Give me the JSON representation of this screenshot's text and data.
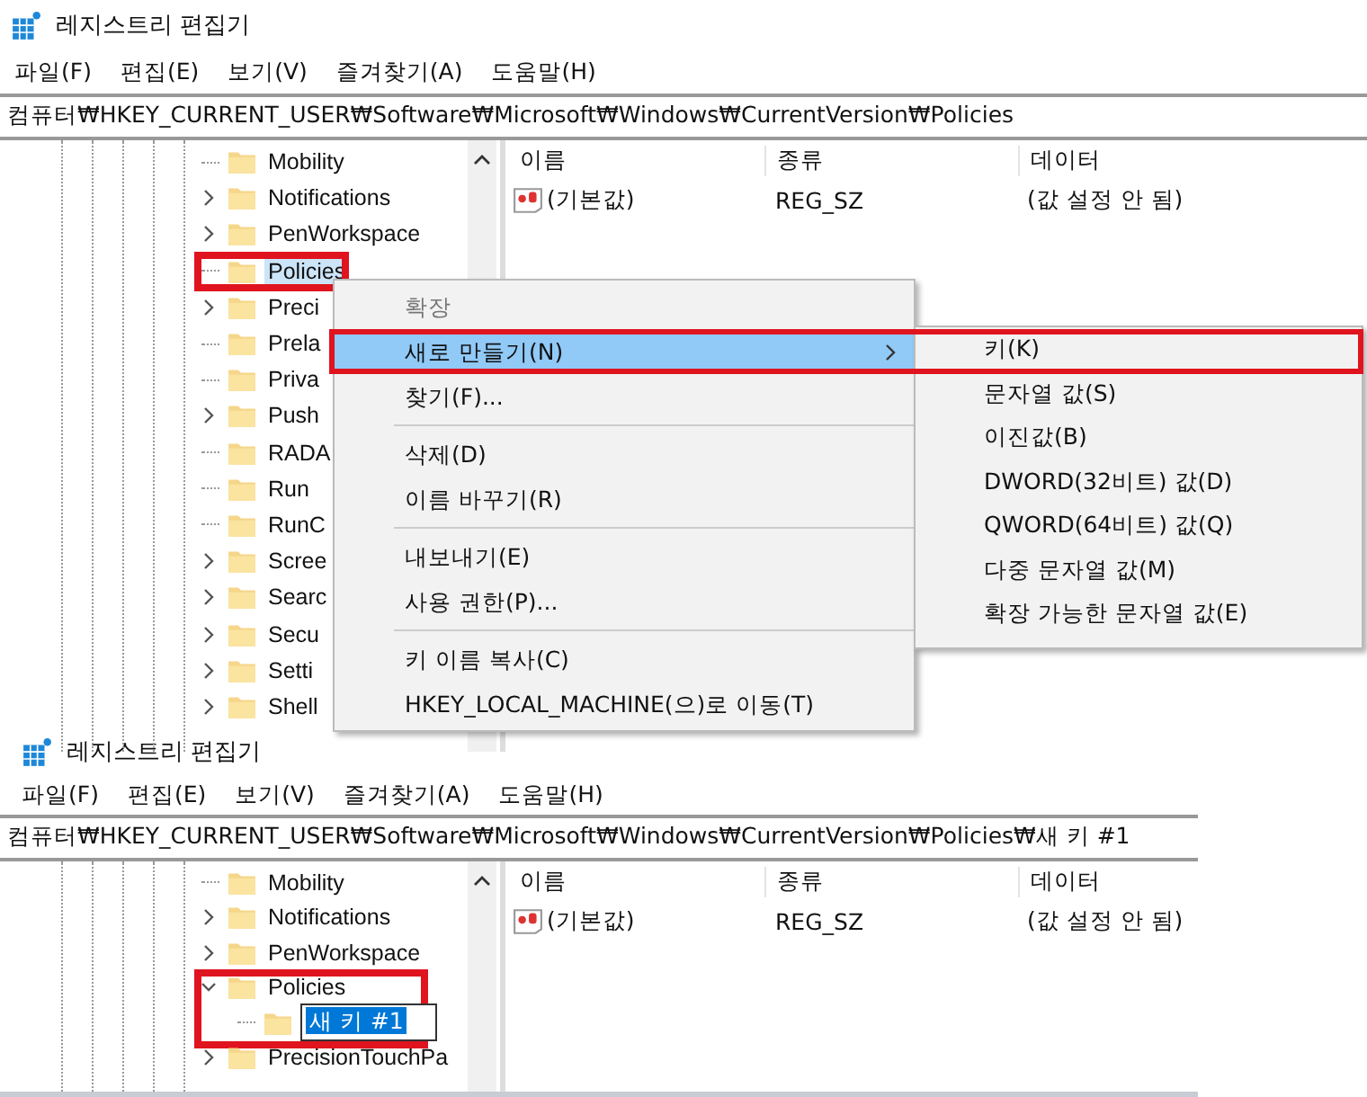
{
  "screens": [
    {
      "window": {
        "title": "레지스트리 편집기"
      },
      "menu": [
        "파일(F)",
        "편집(E)",
        "보기(V)",
        "즐겨찾기(A)",
        "도움말(H)"
      ],
      "address": "컴퓨터₩HKEY_CURRENT_USER₩Software₩Microsoft₩Windows₩CurrentVersion₩Policies",
      "tree": [
        {
          "label": "Mobility",
          "expandable": false,
          "selected": false
        },
        {
          "label": "Notifications",
          "expandable": true,
          "expanded": false,
          "selected": false
        },
        {
          "label": "PenWorkspace",
          "expandable": true,
          "expanded": false,
          "selected": false
        },
        {
          "label": "Policies",
          "expandable": false,
          "selected": true,
          "highlighted": true
        },
        {
          "label": "Preci",
          "expandable": true,
          "expanded": false,
          "selected": false
        },
        {
          "label": "Prela",
          "expandable": false,
          "selected": false
        },
        {
          "label": "Priva",
          "expandable": false,
          "selected": false
        },
        {
          "label": "Push",
          "expandable": true,
          "expanded": false,
          "selected": false
        },
        {
          "label": "RADA",
          "expandable": false,
          "selected": false
        },
        {
          "label": "Run",
          "expandable": false,
          "selected": false
        },
        {
          "label": "RunC",
          "expandable": false,
          "selected": false
        },
        {
          "label": "Scree",
          "expandable": true,
          "expanded": false,
          "selected": false
        },
        {
          "label": "Searc",
          "expandable": true,
          "expanded": false,
          "selected": false
        },
        {
          "label": "Secu",
          "expandable": true,
          "expanded": false,
          "selected": false
        },
        {
          "label": "Setti",
          "expandable": true,
          "expanded": false,
          "selected": false
        },
        {
          "label": "Shell",
          "expandable": true,
          "expanded": false,
          "selected": false
        }
      ],
      "list": {
        "columns": [
          "이름",
          "종류",
          "데이터"
        ],
        "rows": [
          {
            "name": "(기본값)",
            "type": "REG_SZ",
            "data": "(값 설정 안 됨)"
          }
        ]
      },
      "context_menu": {
        "items": [
          {
            "kind": "item",
            "label": "확장",
            "disabled": true,
            "selected": false
          },
          {
            "kind": "item",
            "label": "새로 만들기(N)",
            "disabled": false,
            "selected": true,
            "submenu": true,
            "highlighted": true
          },
          {
            "kind": "item",
            "label": "찾기(F)...",
            "disabled": false,
            "selected": false
          },
          {
            "kind": "separator"
          },
          {
            "kind": "item",
            "label": "삭제(D)",
            "disabled": false,
            "selected": false
          },
          {
            "kind": "item",
            "label": "이름 바꾸기(R)",
            "disabled": false,
            "selected": false
          },
          {
            "kind": "separator"
          },
          {
            "kind": "item",
            "label": "내보내기(E)",
            "disabled": false,
            "selected": false
          },
          {
            "kind": "item",
            "label": "사용 권한(P)...",
            "disabled": false,
            "selected": false
          },
          {
            "kind": "separator"
          },
          {
            "kind": "item",
            "label": "키 이름 복사(C)",
            "disabled": false,
            "selected": false
          },
          {
            "kind": "item",
            "label": "HKEY_LOCAL_MACHINE(으)로 이동(T)",
            "disabled": false,
            "selected": false
          }
        ],
        "submenu": [
          "키(K)",
          "문자열 값(S)",
          "이진값(B)",
          "DWORD(32비트) 값(D)",
          "QWORD(64비트) 값(Q)",
          "다중 문자열 값(M)",
          "확장 가능한 문자열 값(E)"
        ]
      }
    },
    {
      "window": {
        "title": "레지스트리 편집기"
      },
      "menu": [
        "파일(F)",
        "편집(E)",
        "보기(V)",
        "즐겨찾기(A)",
        "도움말(H)"
      ],
      "address": "컴퓨터₩HKEY_CURRENT_USER₩Software₩Microsoft₩Windows₩CurrentVersion₩Policies₩새 키 #1",
      "tree": [
        {
          "label": "Mobility",
          "expandable": false,
          "selected": false
        },
        {
          "label": "Notifications",
          "expandable": true,
          "expanded": false,
          "selected": false
        },
        {
          "label": "PenWorkspace",
          "expandable": true,
          "expanded": false,
          "selected": false
        },
        {
          "label": "Policies",
          "expandable": true,
          "expanded": true,
          "selected": false,
          "highlighted": true,
          "children": [
            {
              "label": "새 키 #1",
              "expandable": false,
              "selected": true,
              "editing": true
            }
          ]
        },
        {
          "label": "PrecisionTouchPa",
          "expandable": true,
          "expanded": false,
          "selected": false
        }
      ],
      "list": {
        "columns": [
          "이름",
          "종류",
          "데이터"
        ],
        "rows": [
          {
            "name": "(기본값)",
            "type": "REG_SZ",
            "data": "(값 설정 안 됨)"
          }
        ]
      }
    }
  ]
}
